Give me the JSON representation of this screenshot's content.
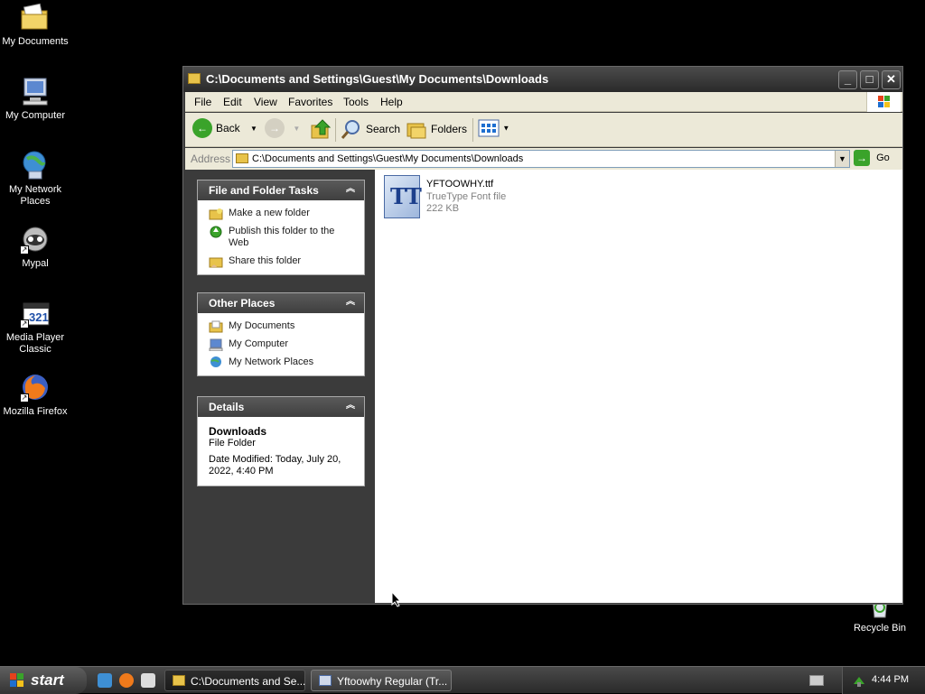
{
  "desktop": {
    "icons": [
      {
        "label": "My Documents",
        "icon": "my-documents-icon"
      },
      {
        "label": "My Computer",
        "icon": "my-computer-icon"
      },
      {
        "label": "My Network Places",
        "icon": "network-places-icon"
      },
      {
        "label": "Mypal",
        "icon": "mypal-icon"
      },
      {
        "label": "Media Player Classic",
        "icon": "media-player-icon"
      },
      {
        "label": "Mozilla Firefox",
        "icon": "firefox-icon"
      },
      {
        "label": "Recycle Bin",
        "icon": "recycle-bin-icon"
      }
    ]
  },
  "window": {
    "title": "C:\\Documents and Settings\\Guest\\My Documents\\Downloads",
    "menu": [
      "File",
      "Edit",
      "View",
      "Favorites",
      "Tools",
      "Help"
    ],
    "toolbar": {
      "back": "Back",
      "search": "Search",
      "folders": "Folders"
    },
    "address": {
      "label": "Address",
      "value": "C:\\Documents and Settings\\Guest\\My Documents\\Downloads",
      "go": "Go"
    },
    "panels": {
      "tasks": {
        "title": "File and Folder Tasks",
        "items": [
          "Make a new folder",
          "Publish this folder to the Web",
          "Share this folder"
        ]
      },
      "other": {
        "title": "Other Places",
        "items": [
          "My Documents",
          "My Computer",
          "My Network Places"
        ]
      },
      "details": {
        "title": "Details",
        "name": "Downloads",
        "type": "File Folder",
        "modified": "Date Modified: Today, July 20, 2022, 4:40 PM"
      }
    },
    "file": {
      "name": "YFTOOWHY.ttf",
      "type": "TrueType Font file",
      "size": "222 KB",
      "icon_glyph": "TT"
    }
  },
  "taskbar": {
    "start": "start",
    "tasks": [
      {
        "label": "C:\\Documents and Se...",
        "active": true
      },
      {
        "label": "Yftoowhy Regular (Tr...",
        "active": false
      }
    ],
    "clock": "4:44 PM"
  },
  "colors": {
    "accent_green": "#3aa32a",
    "folder_yellow": "#e8c34a",
    "panel_header": "#4a4a4a"
  }
}
